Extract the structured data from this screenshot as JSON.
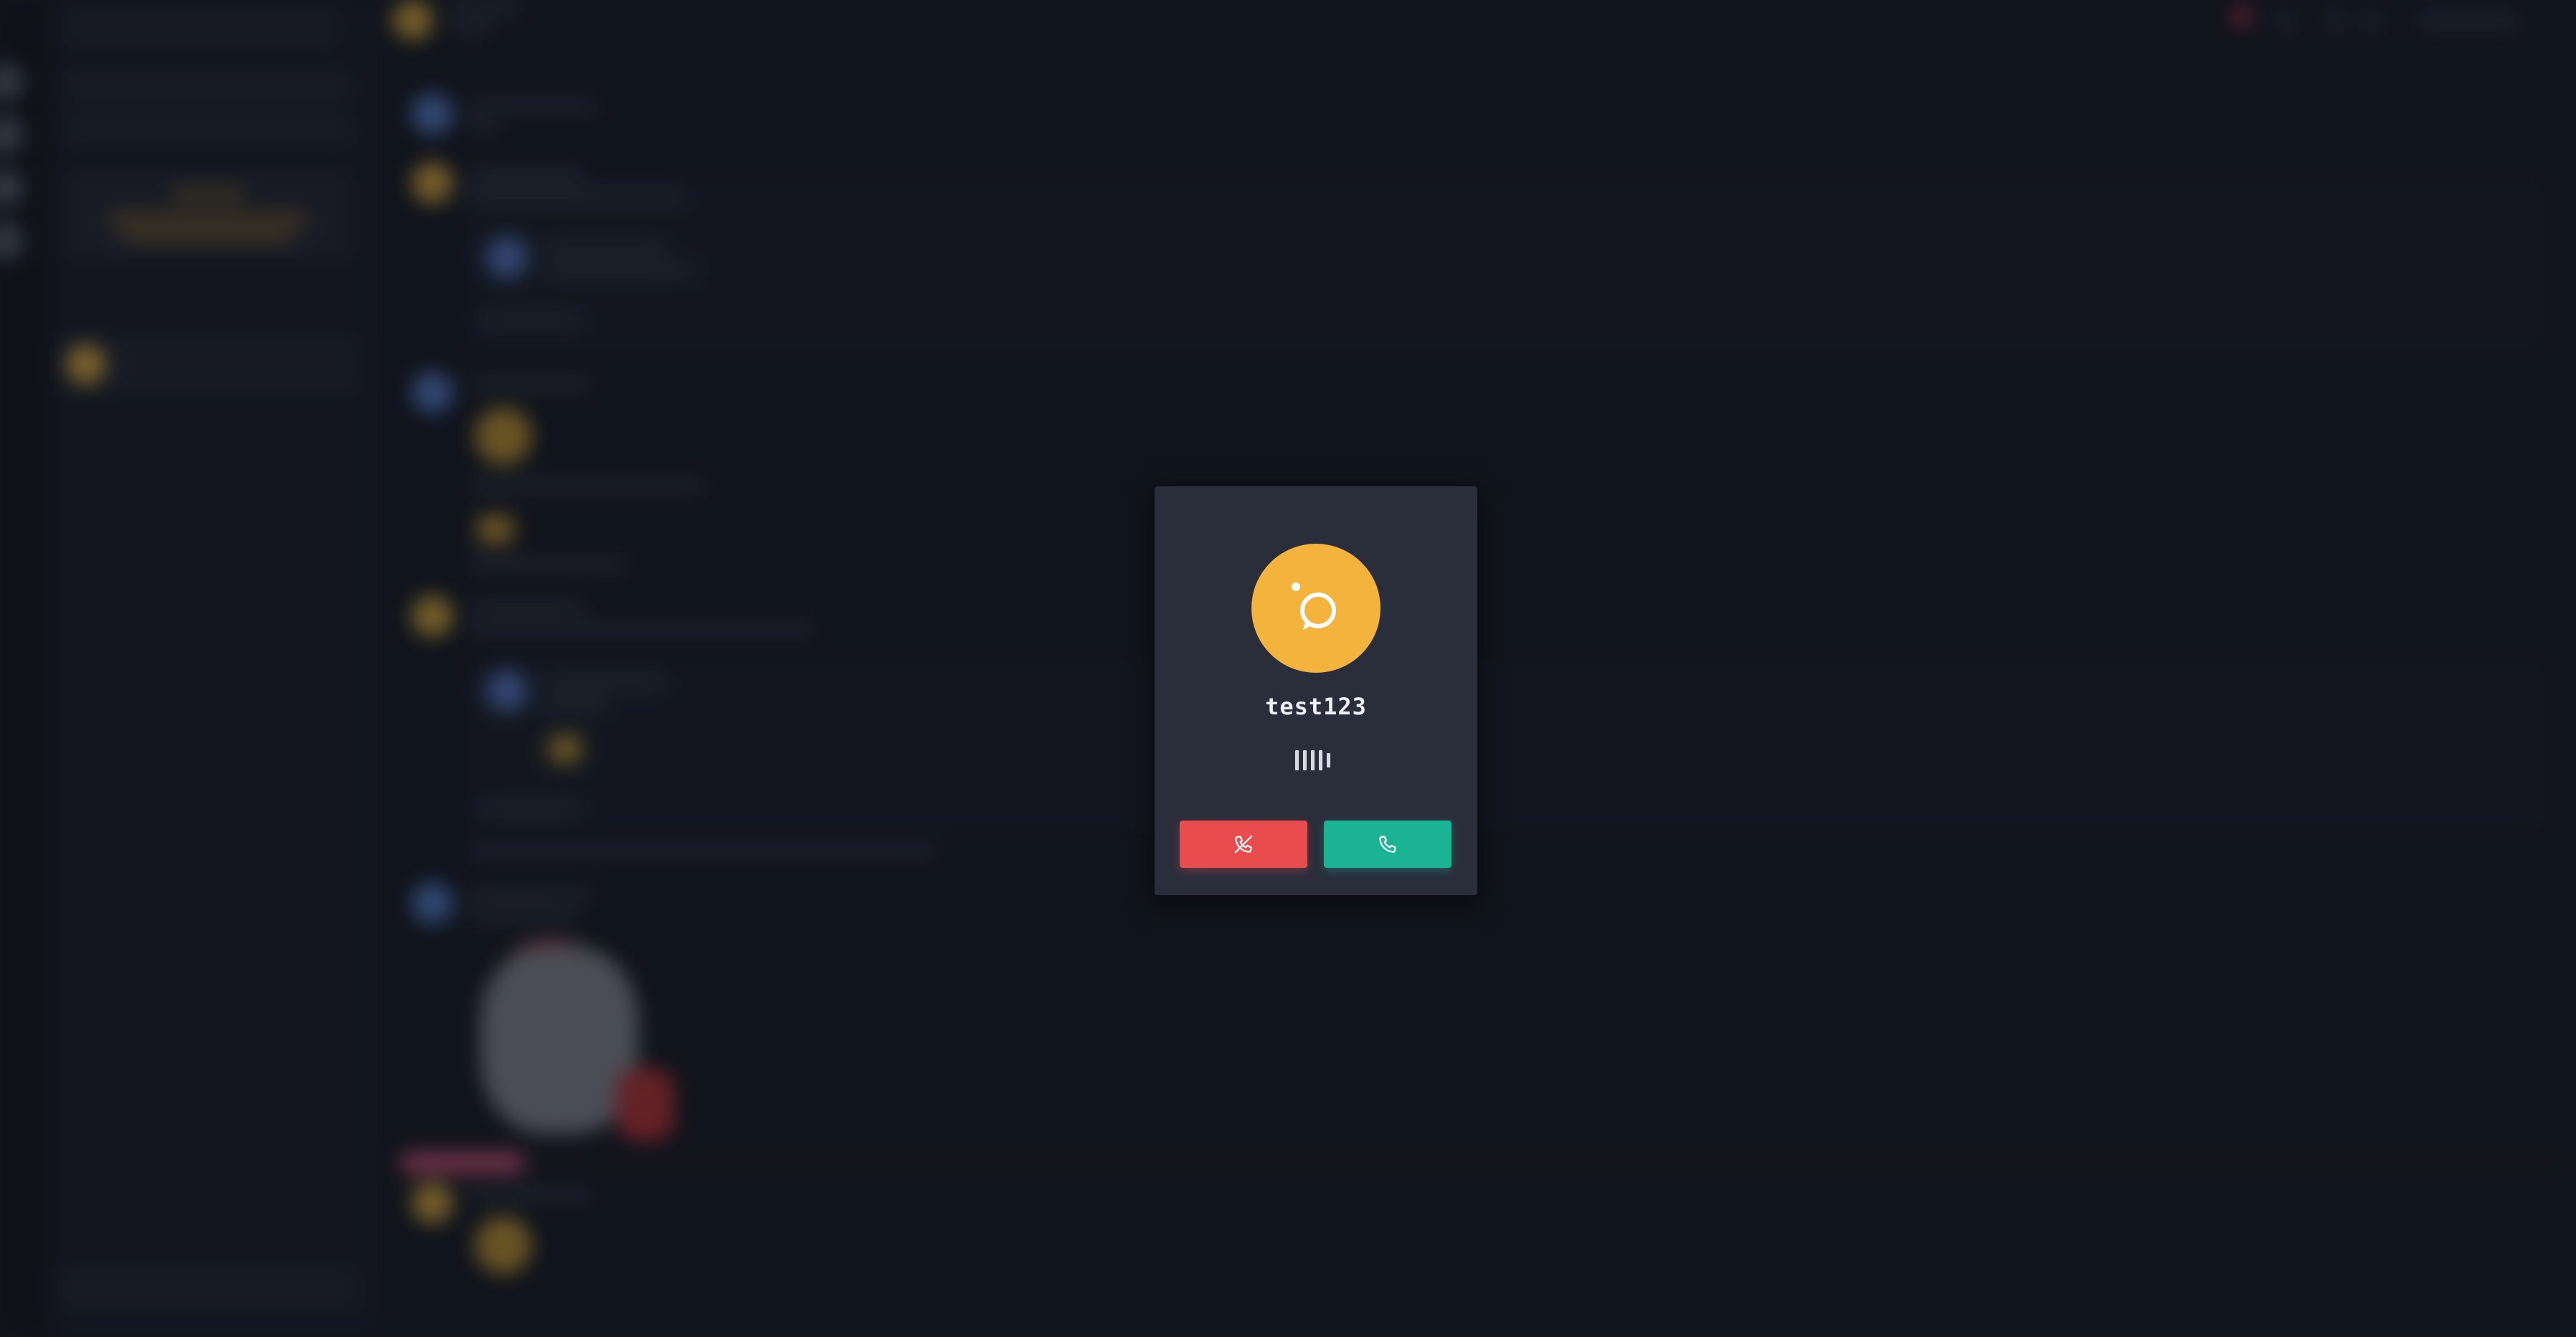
{
  "call": {
    "caller_name": "test123",
    "avatar_color": "#f4b33d",
    "status_icon": "ringing-bars-icon",
    "decline_button": {
      "icon": "phone-hangup-icon",
      "color": "#e84c4c"
    },
    "accept_button": {
      "icon": "phone-icon",
      "color": "#1ab394"
    }
  },
  "colors": {
    "background": "#161a24",
    "modal": "#2a2e3b"
  }
}
